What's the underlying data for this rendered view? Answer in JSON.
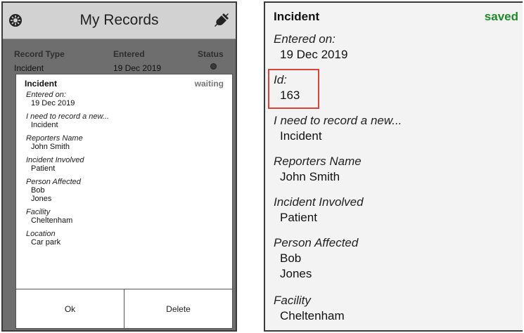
{
  "left_screen": {
    "app_title": "My Records",
    "list": {
      "headers": {
        "record_type": "Record Type",
        "entered": "Entered",
        "status": "Status"
      },
      "rows": [
        {
          "record_type": "Incident",
          "entered": "19 Dec 2019",
          "status_icon": "check-circle-icon"
        }
      ]
    },
    "dialog": {
      "title": "Incident",
      "status": "waiting",
      "fields": [
        {
          "label": "Entered on:",
          "value": "19 Dec 2019"
        },
        {
          "label": "I need to record a new...",
          "value": "Incident"
        },
        {
          "label": "Reporters Name",
          "value": "John Smith"
        },
        {
          "label": "Incident Involved",
          "value": "Patient"
        },
        {
          "label": "Person Affected",
          "value_line1": "Bob",
          "value_line2": "Jones"
        },
        {
          "label": "Facility",
          "value": "Cheltenham"
        },
        {
          "label": "Location",
          "value": "Car park"
        }
      ],
      "ok_label": "Ok",
      "delete_label": "Delete"
    }
  },
  "right_screen": {
    "title": "Incident",
    "status": "saved",
    "status_color": "#1e8a2a",
    "fields": [
      {
        "label": "Entered on:",
        "value": "19 Dec 2019"
      },
      {
        "label": "Id:",
        "value": "163"
      },
      {
        "label": "I need to record a new...",
        "value": "Incident"
      },
      {
        "label": "Reporters Name",
        "value": "John Smith"
      },
      {
        "label": "Incident Involved",
        "value": "Patient"
      },
      {
        "label": "Person Affected",
        "value_line1": "Bob",
        "value_line2": "Jones"
      },
      {
        "label": "Facility",
        "value": "Cheltenham"
      }
    ],
    "highlight_color": "#d9453d"
  }
}
